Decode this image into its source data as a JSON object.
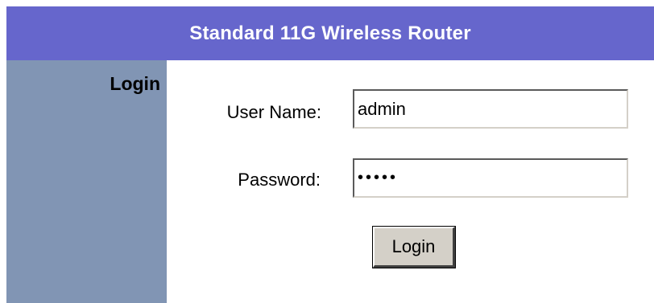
{
  "header": {
    "title": "Standard 11G Wireless Router"
  },
  "sidebar": {
    "title": "Login"
  },
  "form": {
    "username_label": "User Name:",
    "username_value": "admin",
    "password_label": "Password:",
    "password_value": "•••••",
    "login_button_label": "Login"
  },
  "colors": {
    "header_bg": "#6666cc",
    "sidebar_bg": "#8195b4"
  }
}
